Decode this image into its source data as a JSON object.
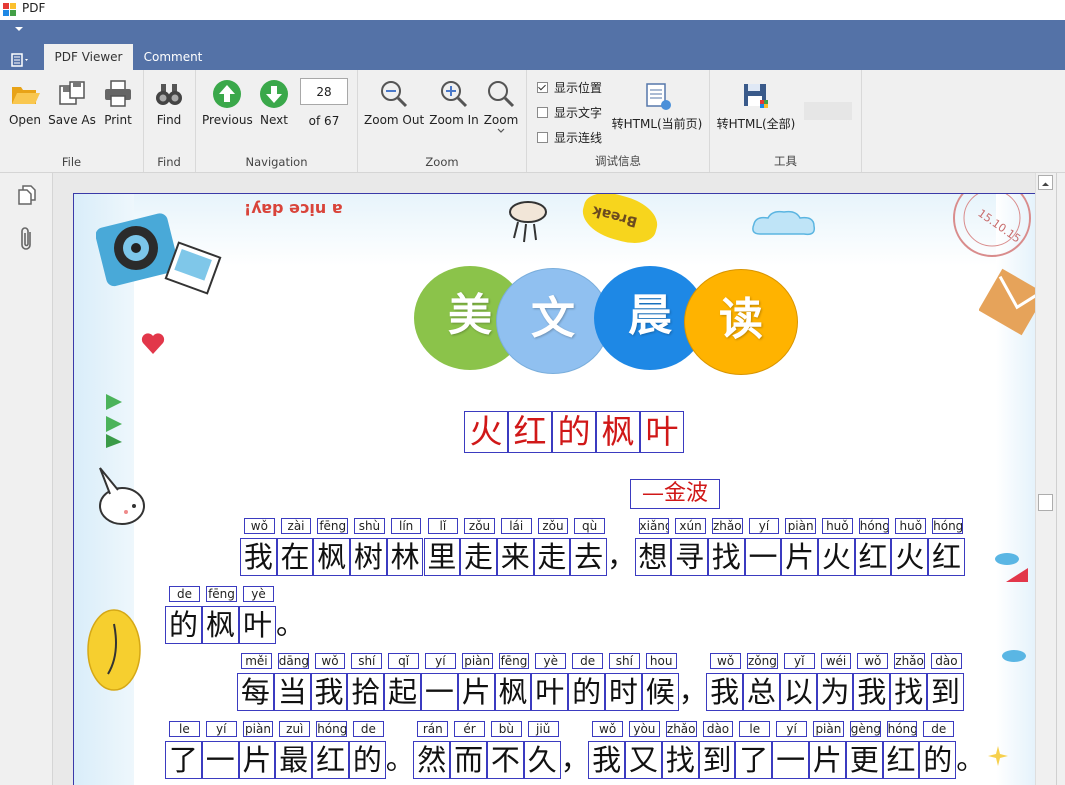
{
  "window": {
    "title": "PDF"
  },
  "tabs": [
    {
      "label": "PDF Viewer",
      "active": true
    },
    {
      "label": "Comment",
      "active": false
    }
  ],
  "ribbon": {
    "file": {
      "label": "File",
      "open": "Open",
      "save_as": "Save As",
      "print": "Print"
    },
    "find": {
      "label": "Find",
      "find": "Find"
    },
    "navigation": {
      "label": "Navigation",
      "previous": "Previous",
      "next": "Next",
      "page_value": "28",
      "page_of": "of 67"
    },
    "zoom": {
      "label": "Zoom",
      "zoom_out": "Zoom Out",
      "zoom_in": "Zoom In",
      "zoom": "Zoom"
    },
    "debug": {
      "label": "调试信息",
      "show_position": {
        "label": "显示位置",
        "checked": true
      },
      "show_text": {
        "label": "显示文字",
        "checked": false
      },
      "show_links": {
        "label": "显示连线",
        "checked": false
      },
      "to_html_current": "转HTML(当前页)"
    },
    "tools": {
      "label": "工具",
      "to_html_all": "转HTML(全部)"
    }
  },
  "document": {
    "header_chars": [
      "美",
      "文",
      "晨",
      "读"
    ],
    "header_colors": [
      "#8bc34a",
      "#90c0f0",
      "#1e88e5",
      "#ffb300"
    ],
    "title_chars": [
      "火",
      "红",
      "的",
      "枫",
      "叶"
    ],
    "author": "—金波",
    "deco_texts": {
      "top_left": "!yab ɘɔin",
      "top_mid": "a nice day!",
      "break": "Break",
      "stamp": "15.10.15"
    },
    "lines": [
      {
        "pinyin": [
          "wǒ",
          "zài",
          "fēng",
          "shù",
          "lín",
          "lǐ",
          "zǒu",
          "lái",
          "zǒu",
          "qù",
          "",
          "xiǎng",
          "xún",
          "zhǎo",
          "yí",
          "piàn",
          "huǒ",
          "hóng",
          "huǒ",
          "hóng"
        ],
        "chars": [
          "我",
          "在",
          "枫",
          "树",
          "林",
          "里",
          "走",
          "来",
          "走",
          "去",
          "，",
          "想",
          "寻",
          "找",
          "一",
          "片",
          "火",
          "红",
          "火",
          "红"
        ]
      },
      {
        "pinyin": [
          "de",
          "fēng",
          "yè",
          ""
        ],
        "chars": [
          "的",
          "枫",
          "叶",
          "。"
        ]
      },
      {
        "pinyin": [
          "měi",
          "dāng",
          "wǒ",
          "shí",
          "qǐ",
          "yí",
          "piàn",
          "fēng",
          "yè",
          "de",
          "shí",
          "hou",
          "",
          "wǒ",
          "zǒng",
          "yǐ",
          "wéi",
          "wǒ",
          "zhǎo",
          "dào"
        ],
        "chars": [
          "每",
          "当",
          "我",
          "拾",
          "起",
          "一",
          "片",
          "枫",
          "叶",
          "的",
          "时",
          "候",
          "，",
          "我",
          "总",
          "以",
          "为",
          "我",
          "找",
          "到"
        ]
      },
      {
        "pinyin": [
          "le",
          "yí",
          "piàn",
          "zuì",
          "hóng",
          "de",
          "",
          "rán",
          "ér",
          "bù",
          "jiǔ",
          "",
          "wǒ",
          "yòu",
          "zhǎo",
          "dào",
          "le",
          "yí",
          "piàn",
          "gèng",
          "hóng",
          "de",
          ""
        ],
        "chars": [
          "了",
          "一",
          "片",
          "最",
          "红",
          "的",
          "。",
          "然",
          "而",
          "不",
          "久",
          "，",
          "我",
          "又",
          "找",
          "到",
          "了",
          "一",
          "片",
          "更",
          "红",
          "的",
          "。"
        ]
      }
    ]
  },
  "colors": {
    "ribbon_blue": "#5472a7",
    "title_red": "#d01818",
    "box_blue": "#3b3bc0"
  }
}
